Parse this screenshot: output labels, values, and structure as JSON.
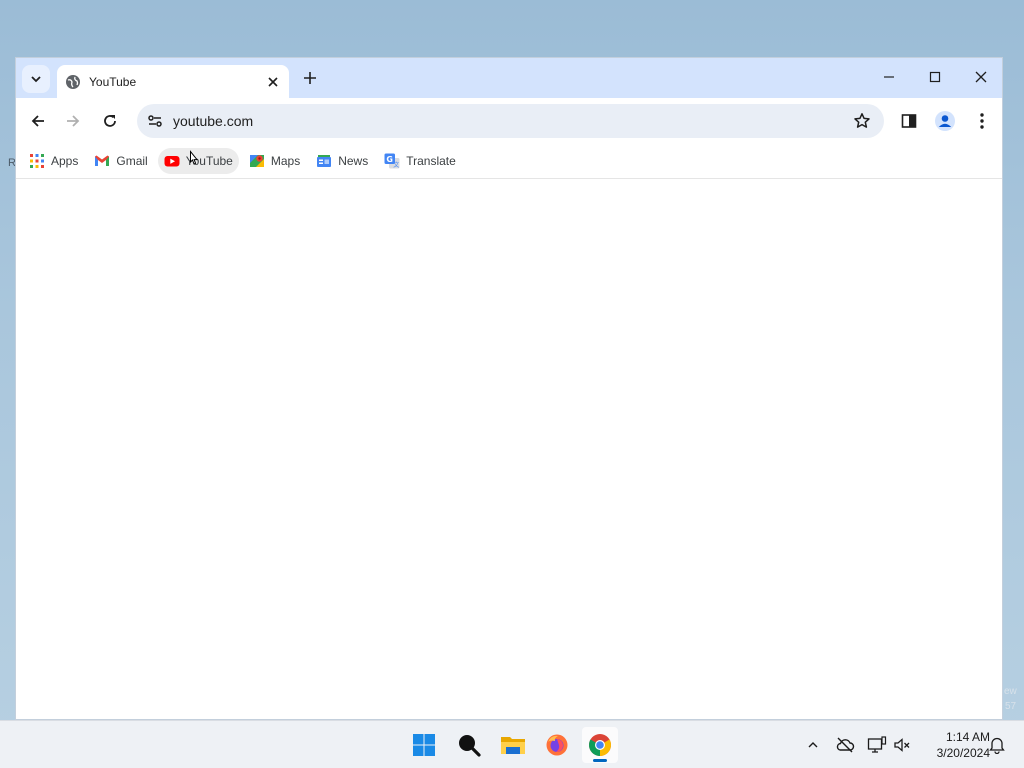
{
  "window": {
    "tab": {
      "title": "YouTube"
    },
    "omnibox": {
      "url": "youtube.com"
    },
    "bookmarks": [
      {
        "label": "Apps",
        "icon": "apps-grid-icon"
      },
      {
        "label": "Gmail",
        "icon": "gmail-icon"
      },
      {
        "label": "YouTube",
        "icon": "youtube-icon"
      },
      {
        "label": "Maps",
        "icon": "maps-icon"
      },
      {
        "label": "News",
        "icon": "news-icon"
      },
      {
        "label": "Translate",
        "icon": "translate-icon"
      }
    ]
  },
  "taskbar": {
    "apps": [
      "start-icon",
      "search-icon",
      "file-explorer-icon",
      "firefox-icon",
      "chrome-icon"
    ],
    "clock": {
      "time": "1:14 AM",
      "date": "3/20/2024"
    }
  },
  "colors": {
    "titlebar": "#d3e3fd",
    "omnibox": "#e9eef6",
    "accent": "#0067c0"
  }
}
